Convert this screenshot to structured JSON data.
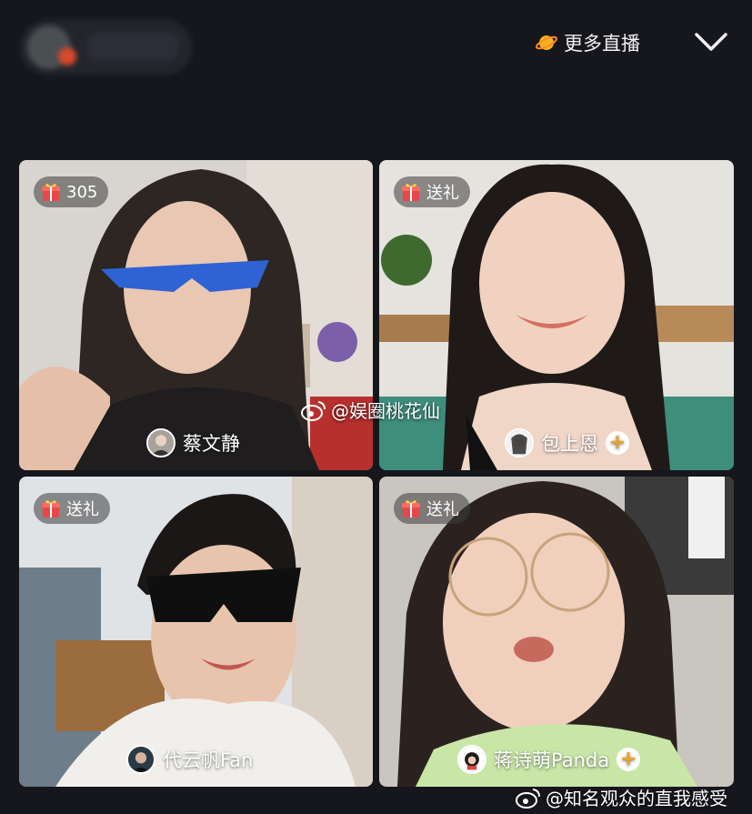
{
  "header": {
    "more_live_label": "更多直播",
    "planet_icon": "planet-icon",
    "collapse_icon": "chevron-down-icon"
  },
  "tiles": [
    {
      "badge": "305",
      "name": "蔡文静",
      "has_follow": false
    },
    {
      "badge": "送礼",
      "name": "包上恩",
      "has_follow": true
    },
    {
      "badge": "送礼",
      "name": "代云帆Fan",
      "has_follow": false
    },
    {
      "badge": "送礼",
      "name": "蒋诗萌Panda",
      "has_follow": true
    }
  ],
  "follow_label": "+",
  "watermarks": {
    "center": "@娱圈桃花仙",
    "bottom": "@知名观众的直我感受"
  },
  "colors": {
    "background": "#16171d",
    "follow_accent": "#f0a21b",
    "gift_red": "#e8474a"
  }
}
